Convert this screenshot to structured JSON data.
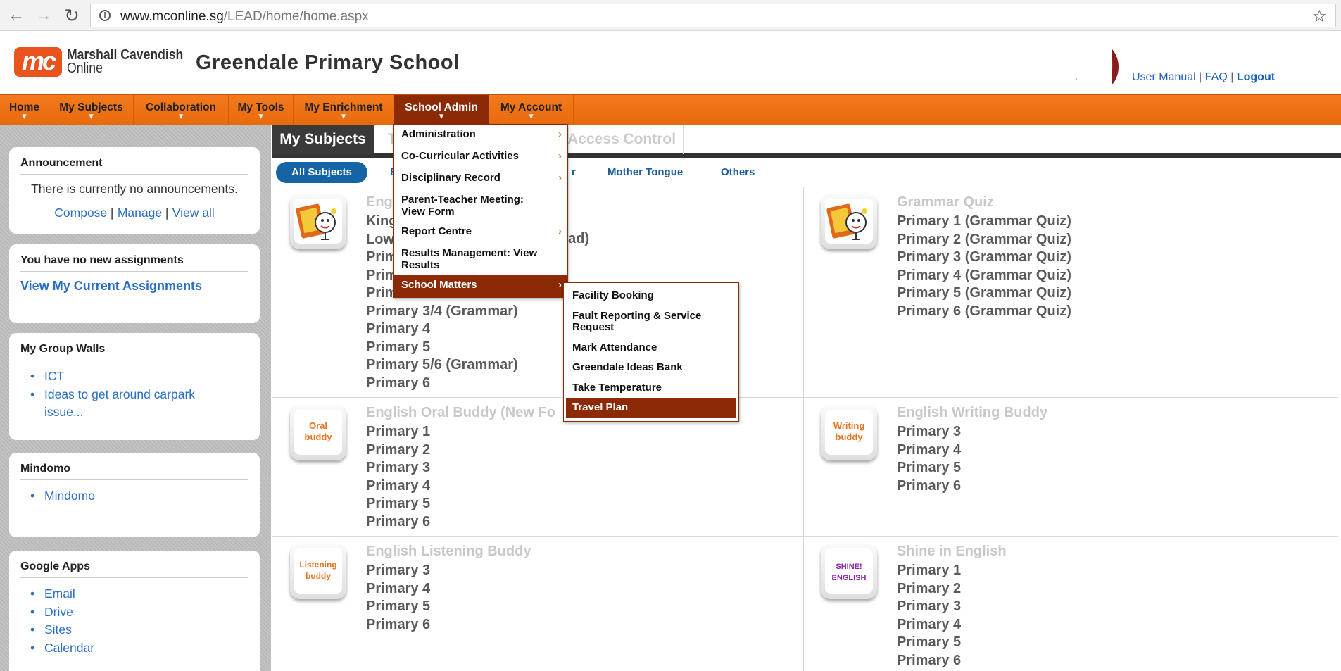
{
  "browser": {
    "url_host": "www.mconline.sg",
    "url_path": "/LEAD/home/home.aspx"
  },
  "header": {
    "logo_mark": "mc",
    "logo_line1": "Marshall Cavendish",
    "logo_line2": "Online",
    "school_name": "Greendale Primary School",
    "user_manual": "User Manual",
    "faq": "FAQ",
    "logout": "Logout",
    "sep": "|"
  },
  "nav": {
    "items": [
      {
        "label": "Home"
      },
      {
        "label": "My Subjects"
      },
      {
        "label": "Collaboration"
      },
      {
        "label": "My Tools"
      },
      {
        "label": "My Enrichment"
      },
      {
        "label": "School Admin"
      },
      {
        "label": "My Account"
      }
    ]
  },
  "sidebar": {
    "announcement": {
      "title": "Announcement",
      "text": "There is currently no announcements.",
      "compose": "Compose",
      "manage": "Manage",
      "view_all": "View all",
      "sep": "|"
    },
    "assignments": {
      "title": "You have no new assignments",
      "link": "View My Current Assignments"
    },
    "group_walls": {
      "title": "My Group Walls",
      "items": [
        "ICT",
        "Ideas to get around carpark issue..."
      ]
    },
    "mindomo": {
      "title": "Mindomo",
      "items": [
        "Mindomo"
      ]
    },
    "google_apps": {
      "title": "Google Apps",
      "items": [
        "Email",
        "Drive",
        "Sites",
        "Calendar"
      ]
    }
  },
  "content": {
    "tabs": {
      "my_subjects": "My Subjects",
      "t": "T",
      "access_control": "Access Control"
    },
    "subtabs": {
      "all_subjects": "All Subjects",
      "e": "E",
      "r": "r",
      "mother_tongue": "Mother Tongue",
      "others": "Others"
    },
    "cards": {
      "c1": {
        "title": "Eng",
        "items": [
          "King",
          "Low",
          "Prim",
          "Prim",
          "Prim",
          "Primary 3/4 (Grammar)",
          "Primary 4",
          "Primary 5",
          "Primary 5/6 (Grammar)",
          "Primary 6"
        ],
        "partial": "ead)"
      },
      "c2": {
        "title": "Grammar Quiz",
        "items": [
          "Primary 1 (Grammar Quiz)",
          "Primary 2 (Grammar Quiz)",
          "Primary 3 (Grammar Quiz)",
          "Primary 4 (Grammar Quiz)",
          "Primary 5 (Grammar Quiz)",
          "Primary 6 (Grammar Quiz)"
        ]
      },
      "c3": {
        "title": "English Oral Buddy (New Fo",
        "items": [
          "Primary 1",
          "Primary 2",
          "Primary 3",
          "Primary 4",
          "Primary 5",
          "Primary 6"
        ]
      },
      "c4": {
        "title": "English Writing Buddy",
        "items": [
          "Primary 3",
          "Primary 4",
          "Primary 5",
          "Primary 6"
        ]
      },
      "c5": {
        "title": "English Listening Buddy",
        "items": [
          "Primary 3",
          "Primary 4",
          "Primary 5",
          "Primary 6"
        ]
      },
      "c6": {
        "title": "Shine in English",
        "items": [
          "Primary 1",
          "Primary 2",
          "Primary 3",
          "Primary 4",
          "Primary 5",
          "Primary 6"
        ]
      }
    },
    "icons": {
      "oral": "Oral buddy",
      "writing": "Writing buddy",
      "listening": "Listening buddy",
      "shine": "SHINE! ENGLISH"
    }
  },
  "school_admin_menu": {
    "items": [
      "Administration",
      "Co-Curricular Activities",
      "Disciplinary Record",
      "Parent-Teacher Meeting: View Form",
      "Report Centre",
      "Results Management: View Results",
      "School Matters"
    ]
  },
  "school_matters_menu": {
    "items": [
      "Facility Booking",
      "Fault Reporting & Service Request",
      "Mark Attendance",
      "Greendale Ideas Bank",
      "Take Temperature",
      "Travel Plan"
    ]
  }
}
